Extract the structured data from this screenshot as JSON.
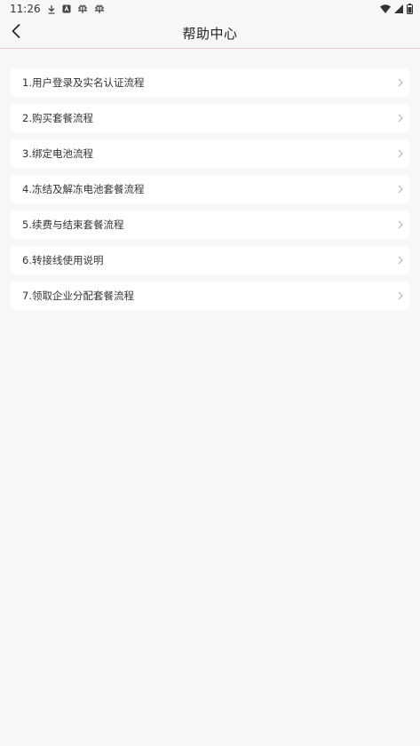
{
  "status_bar": {
    "time": "11:26",
    "icons": [
      "download-icon",
      "notification-a-icon",
      "bug-icon",
      "bug-icon",
      "wifi-icon",
      "signal-icon",
      "battery-icon"
    ]
  },
  "header": {
    "title": "帮助中心",
    "back_icon": "chevron-left-icon"
  },
  "help_items": [
    {
      "label": "1.用户登录及实名认证流程"
    },
    {
      "label": "2.购买套餐流程"
    },
    {
      "label": "3.绑定电池流程"
    },
    {
      "label": "4.冻结及解冻电池套餐流程"
    },
    {
      "label": "5.续费与结束套餐流程"
    },
    {
      "label": "6.转接线使用说明"
    },
    {
      "label": "7.领取企业分配套餐流程"
    }
  ],
  "colors": {
    "background": "#f7f7f7",
    "card": "#ffffff",
    "header_divider": "#f0c8cc",
    "text": "#333333",
    "chevron": "#b0b0b0"
  }
}
